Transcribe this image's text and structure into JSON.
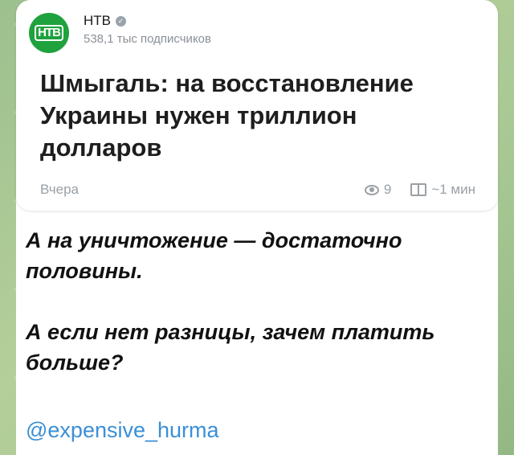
{
  "channel": {
    "name": "НТВ",
    "subscribers": "538,1 тыс подписчиков",
    "avatar_icon": "ntv-logo-icon",
    "avatar_color": "#1fa23e"
  },
  "article": {
    "headline": "Шмыгаль: на восстановление Украины нужен триллион долларов",
    "date": "Вчера",
    "views": "9",
    "read_time": "~1 мин"
  },
  "post": {
    "line1": "А на уничтожение — достаточно половины.",
    "line2": "А если нет разницы, зачем платить больше?",
    "mention": "@expensive_hurma",
    "mention_color": "#3a8fd6"
  }
}
